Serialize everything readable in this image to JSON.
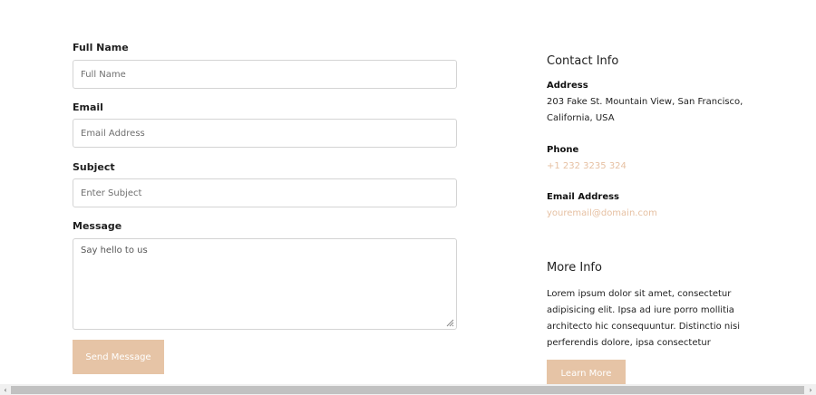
{
  "form": {
    "full_name": {
      "label": "Full Name",
      "placeholder": "Full Name"
    },
    "email": {
      "label": "Email",
      "placeholder": "Email Address"
    },
    "subject": {
      "label": "Subject",
      "placeholder": "Enter Subject"
    },
    "message": {
      "label": "Message",
      "placeholder": "Say hello to us"
    },
    "submit_label": "Send Message"
  },
  "contact_info": {
    "title": "Contact Info",
    "address_label": "Address",
    "address_line1": "203 Fake St. Mountain View, San Francisco,",
    "address_line2": "California, USA",
    "phone_label": "Phone",
    "phone": "+1 232 3235 324",
    "email_label": "Email Address",
    "email": "youremail@domain.com"
  },
  "more_info": {
    "title": "More Info",
    "text_lines": [
      "Lorem ipsum dolor sit amet, consectetur",
      "adipisicing elit. Ipsa ad iure porro mollitia",
      "architecto hic consequuntur. Distinctio nisi",
      "perferendis dolore, ipsa consectetur"
    ],
    "button_label": "Learn More"
  },
  "scrollbar": {
    "left_icon": "‹",
    "right_icon": "›"
  },
  "colors": {
    "accent": "#e6c4a6",
    "link": "#e6c0a2"
  }
}
